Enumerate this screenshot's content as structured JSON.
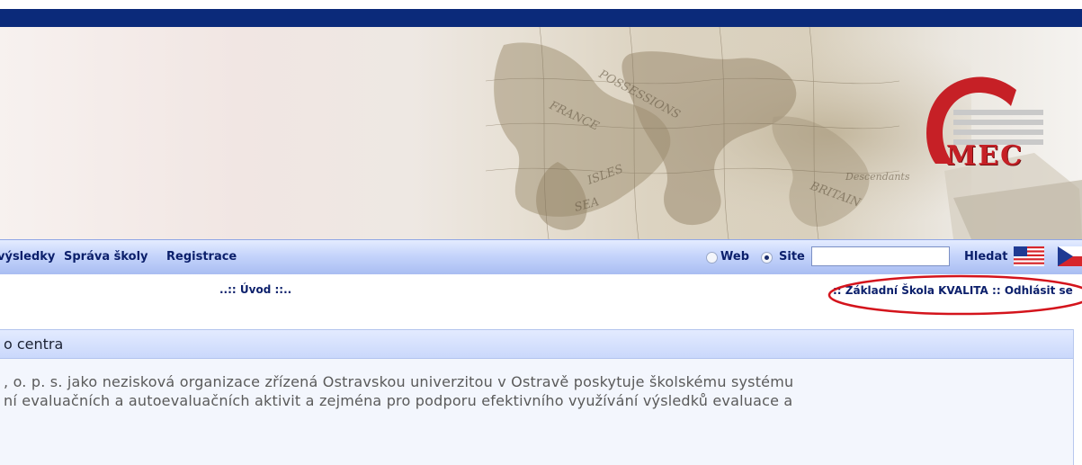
{
  "nav": {
    "items": [
      "výsledky",
      "Správa školy",
      "Registrace"
    ],
    "radio_web": "Web",
    "radio_site": "Site",
    "search_value": "",
    "search_button": "Hledat"
  },
  "logo": {
    "text": "MEC"
  },
  "breadcrumb": "..:: Úvod ::..",
  "user": {
    "school": ":: Základní Škola KVALITA",
    "separator": "::",
    "logout": "Odhlásit se"
  },
  "content": {
    "title": "o centra",
    "lines": [
      ", o. p. s. jako nezisková organizace zřízená Ostravskou univerzitou v Ostravě poskytuje školskému systému",
      "ní evaluačních a autoevaluačních aktivit a zejména pro podporu efektivního využívání výsledků evaluace a"
    ]
  },
  "colors": {
    "top_bar": "#0b2a7a",
    "nav_text": "#0b1f6b",
    "highlight_oval": "#d4141c",
    "logo_red": "#c62026"
  }
}
